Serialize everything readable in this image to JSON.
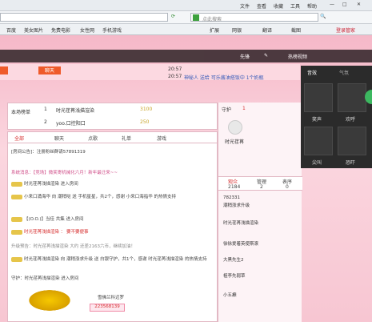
{
  "browser": {
    "menu": [
      "文件",
      "查看",
      "收藏",
      "工具",
      "帮助"
    ],
    "search_placeholder": "点此搜索",
    "bookmarks": [
      "百度",
      "美女图片",
      "免费电影",
      "女性网",
      "手机游戏"
    ],
    "tools": [
      "扩展",
      "网银",
      "翻译",
      "截图",
      "登录管家"
    ]
  },
  "room": {
    "top_labels": [
      "先锋",
      "编辑",
      "热榜"
    ],
    "host_name": "热榜视频",
    "badge": "聊天",
    "time1": "20:57",
    "time2": "20:57",
    "notice1": "神秘人 送给 可乐酱油搭饭中 1个奶瓶",
    "uid_label": "本场榜单",
    "rank": [
      {
        "num": "1",
        "name": "时光荏苒浅描渲染",
        "score": "3100"
      },
      {
        "num": "2",
        "name": "yoo.口控阳口",
        "score": "250"
      }
    ],
    "tabs": [
      "全部",
      "聊天",
      "点歌",
      "礼单",
      "游戏"
    ],
    "room_notice": "[房间公告]：注册粉丝群请57891319",
    "messages": [
      {
        "text": "系统消息：【竞场】微笑寄机械化六月！新年最迁来~~"
      },
      {
        "text": "时光荏苒浅描渲染 进入房间"
      },
      {
        "text": "小来口涌海华 向 潮稍哒 送  手机星星，共2个，感谢 小来口海指华 的热情支持"
      },
      {
        "text": "【(O.O.)】当佳 共集 进入房间"
      },
      {
        "text": "时光荏苒浅描渲染 ： 要不要便事"
      },
      {
        "text": "升级预告：时光荏苒浅描渲染 大约 还差2163六币，继续加油！"
      },
      {
        "text": "时光荏苒浅描渲染 向 潮稍涨求升级 送 白银守护，共1个，感谢 时光荏苒浅描渲染 的热情支持"
      },
      {
        "text": "守护：时光荏苒浅描渲染 进入房间"
      },
      {
        "text": "雪佛兰科迈罗"
      },
      {
        "text": "223568139"
      }
    ],
    "guard_title": "守护",
    "guard_num": "1",
    "guard_user": "时光荏苒",
    "audience": {
      "tabs": [
        "观众",
        "管理",
        "表序"
      ],
      "counts": [
        "2184",
        "2",
        "0"
      ]
    },
    "users": [
      "782331",
      "潮稍涨求升级",
      "时光荏苒浅描渲染",
      "徐徐爱着英使斯滚",
      "大黑先生2",
      "祖李先弱草",
      "小五癫"
    ],
    "right_panel": {
      "tabs": [
        "音效",
        "气氛"
      ],
      "labels": [
        "笑声",
        "欢呼",
        "尖叫",
        "恐吓"
      ]
    }
  }
}
